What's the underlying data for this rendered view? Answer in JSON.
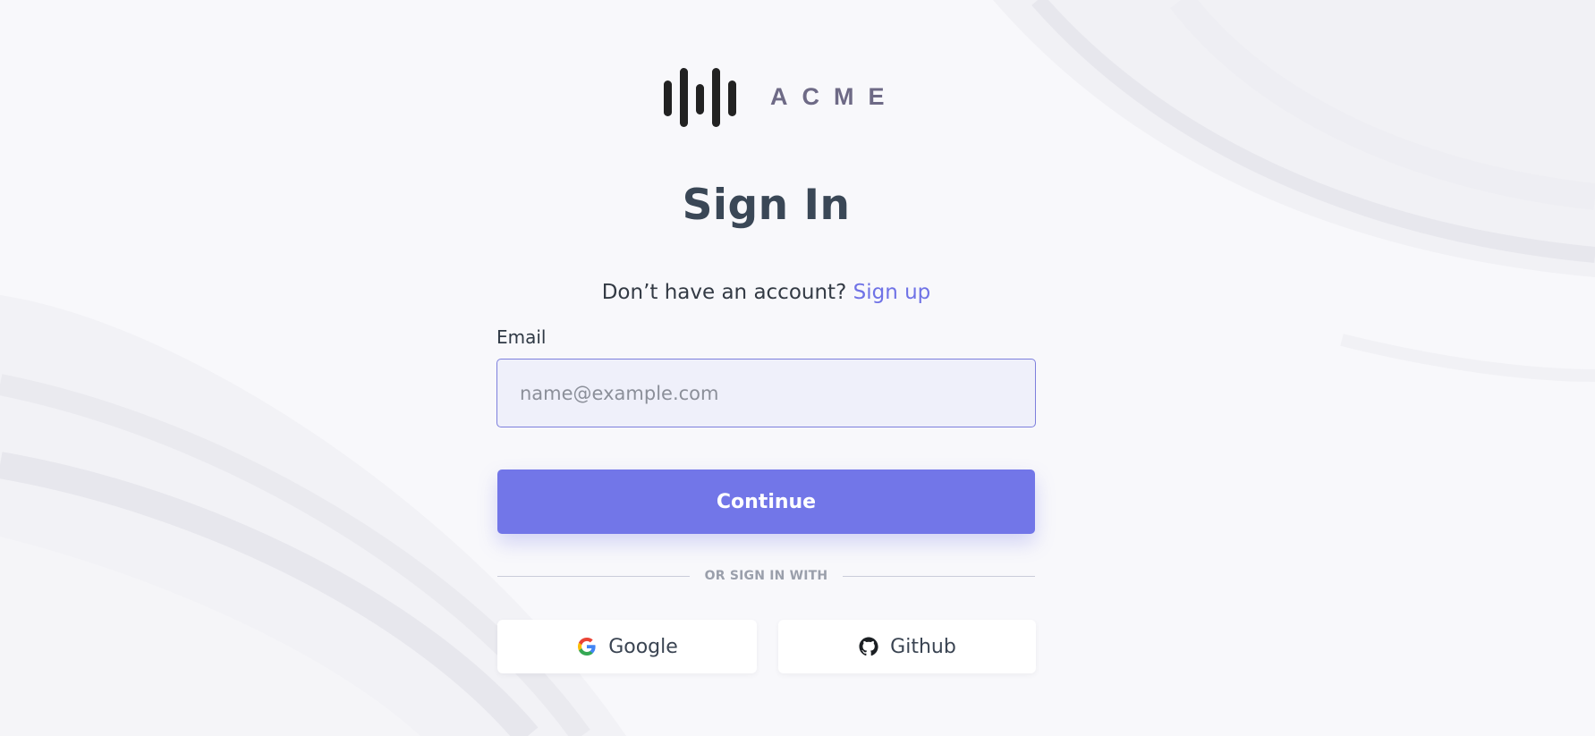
{
  "brand": {
    "name": "ACME",
    "logo_icon": "sound-bars-icon"
  },
  "form": {
    "title": "Sign In",
    "signup_prompt": "Don’t have an account?",
    "signup_link": "Sign up",
    "email_label": "Email",
    "email_placeholder": "name@example.com",
    "email_value": "",
    "continue_label": "Continue",
    "divider_text": "OR SIGN IN WITH"
  },
  "social": {
    "google_label": "Google",
    "google_icon": "google-icon",
    "github_label": "Github",
    "github_icon": "github-icon"
  },
  "colors": {
    "accent": "#7276e8",
    "link": "#6f72e6",
    "title": "#3a4756",
    "input_bg": "#eff0fa",
    "background": "#f8f8fb"
  }
}
